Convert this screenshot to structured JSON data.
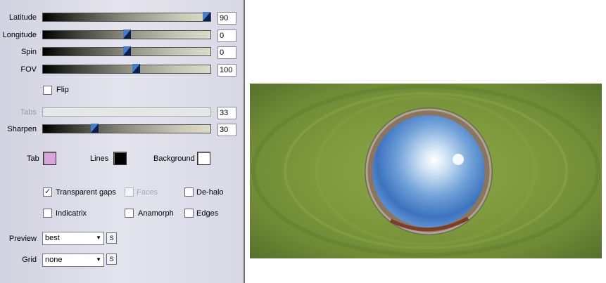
{
  "sliders": [
    {
      "label": "Latitude",
      "value": "90",
      "fraction": 0.98,
      "enabled": true
    },
    {
      "label": "Longitude",
      "value": "0",
      "fraction": 0.5,
      "enabled": true
    },
    {
      "label": "Spin",
      "value": "0",
      "fraction": 0.5,
      "enabled": true
    },
    {
      "label": "FOV",
      "value": "100",
      "fraction": 0.56,
      "enabled": true
    },
    {
      "label": "Tabs",
      "value": "33",
      "fraction": null,
      "enabled": false
    },
    {
      "label": "Sharpen",
      "value": "30",
      "fraction": 0.3,
      "enabled": true
    }
  ],
  "flip": {
    "label": "Flip",
    "checked": false
  },
  "colors": {
    "tab": {
      "label": "Tab",
      "color": "#d7a4dc"
    },
    "lines": {
      "label": "Lines",
      "color": "#000000"
    },
    "background": {
      "label": "Background",
      "color": "#ffffff"
    }
  },
  "options": {
    "transparent_gaps": {
      "label": "Transparent gaps",
      "checked": true,
      "enabled": true
    },
    "faces": {
      "label": "Faces",
      "checked": false,
      "enabled": false
    },
    "dehalo": {
      "label": "De-halo",
      "checked": false,
      "enabled": true
    },
    "indicatrix": {
      "label": "Indicatrix",
      "checked": false,
      "enabled": true
    },
    "anamorph": {
      "label": "Anamorph",
      "checked": false,
      "enabled": true
    },
    "edges": {
      "label": "Edges",
      "checked": false,
      "enabled": true
    }
  },
  "preview": {
    "label": "Preview",
    "value": "best",
    "button": "S"
  },
  "grid": {
    "label": "Grid",
    "value": "none",
    "button": "S"
  }
}
